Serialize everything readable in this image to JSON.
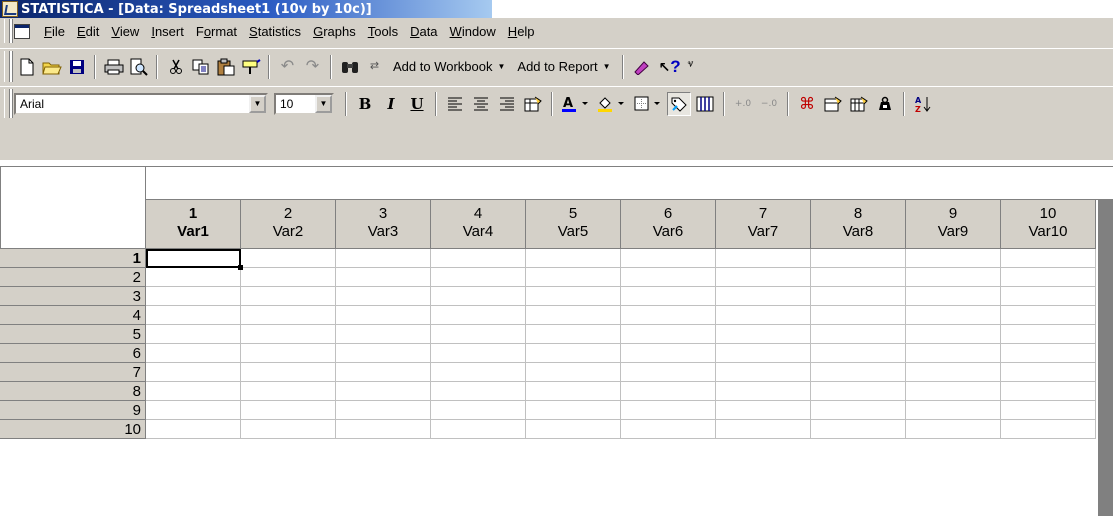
{
  "title": "STATISTICA - [Data: Spreadsheet1 (10v by 10c)]",
  "menu": [
    {
      "label": "File",
      "accel": "F",
      "rest": "ile"
    },
    {
      "label": "Edit",
      "accel": "E",
      "rest": "dit"
    },
    {
      "label": "View",
      "accel": "V",
      "rest": "iew"
    },
    {
      "label": "Insert",
      "accel": "I",
      "rest": "nsert"
    },
    {
      "label": "Format",
      "accel": "o",
      "pre": "F",
      "rest": "rmat"
    },
    {
      "label": "Statistics",
      "accel": "S",
      "rest": "tatistics"
    },
    {
      "label": "Graphs",
      "accel": "G",
      "rest": "raphs"
    },
    {
      "label": "Tools",
      "accel": "T",
      "rest": "ools"
    },
    {
      "label": "Data",
      "accel": "D",
      "rest": "ata"
    },
    {
      "label": "Window",
      "accel": "W",
      "rest": "indow"
    },
    {
      "label": "Help",
      "accel": "H",
      "rest": "elp"
    }
  ],
  "toolbar": {
    "add_to_workbook": "Add to Workbook",
    "add_to_report": "Add to Report",
    "font_name": "Arial",
    "font_size": "10",
    "bold": "B",
    "italic": "I",
    "underline": "U"
  },
  "icons": {
    "new": "new-document-icon",
    "open": "open-folder-icon",
    "save": "save-icon",
    "print": "print-icon",
    "preview": "print-preview-icon",
    "cut": "cut-icon",
    "copy": "copy-icon",
    "paste": "paste-icon",
    "format_painter": "format-painter-icon",
    "undo": "undo-icon",
    "redo": "redo-icon",
    "find": "binoculars-icon",
    "replace": "replace-icon",
    "autotask": "autotask-icon",
    "context_help": "whats-this-help-icon"
  },
  "sheet": {
    "columns": [
      {
        "num": "1",
        "name": "Var1"
      },
      {
        "num": "2",
        "name": "Var2"
      },
      {
        "num": "3",
        "name": "Var3"
      },
      {
        "num": "4",
        "name": "Var4"
      },
      {
        "num": "5",
        "name": "Var5"
      },
      {
        "num": "6",
        "name": "Var6"
      },
      {
        "num": "7",
        "name": "Var7"
      },
      {
        "num": "8",
        "name": "Var8"
      },
      {
        "num": "9",
        "name": "Var9"
      },
      {
        "num": "10",
        "name": "Var10"
      }
    ],
    "rows": [
      "1",
      "2",
      "3",
      "4",
      "5",
      "6",
      "7",
      "8",
      "9",
      "10"
    ],
    "active_cell": {
      "row": "1",
      "col": "1"
    }
  }
}
